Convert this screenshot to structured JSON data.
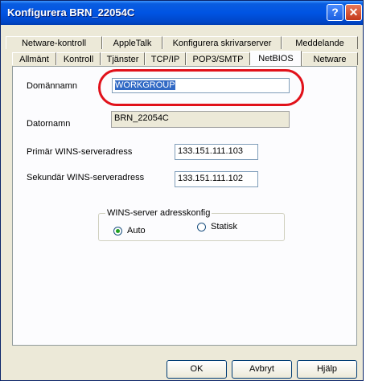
{
  "window": {
    "title": "Konfigurera BRN_22054C",
    "help_glyph": "?",
    "close_glyph": "✕"
  },
  "tabs": {
    "back_row": [
      "Netware-kontroll",
      "AppleTalk",
      "Konfigurera skrivarserver",
      "Meddelande"
    ],
    "front_row": [
      "Allmänt",
      "Kontroll",
      "Tjänster",
      "TCP/IP",
      "POP3/SMTP",
      "NetBIOS",
      "Netware"
    ],
    "active": "NetBIOS"
  },
  "form": {
    "domain_label": "Domännamn",
    "domain_value": "WORKGROUP",
    "computer_label": "Datornamn",
    "computer_value": "BRN_22054C",
    "primary_wins_label": "Primär WINS-serveradress",
    "primary_wins_value": "133.151.111.103",
    "secondary_wins_label": "Sekundär WINS-serveradress",
    "secondary_wins_value": "133.151.111.102",
    "wins_group_title": "WINS-server adresskonfig",
    "radio_auto": "Auto",
    "radio_static": "Statisk",
    "selected_mode": "Auto"
  },
  "buttons": {
    "ok": "OK",
    "cancel": "Avbryt",
    "help": "Hjälp"
  },
  "annotation": {
    "highlight_color": "#e1111a"
  }
}
